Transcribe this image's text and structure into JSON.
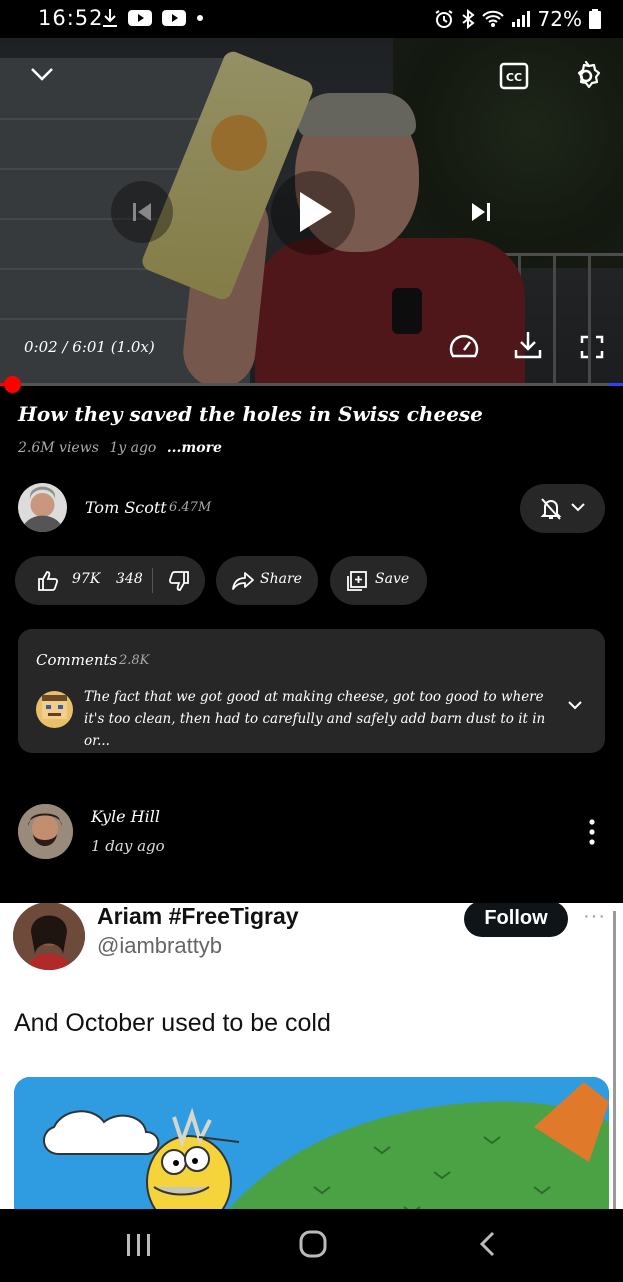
{
  "status_bar": {
    "time": "16:52",
    "battery": "72%",
    "left_icons": [
      "download-icon",
      "youtube-icon",
      "youtube-icon",
      "dot-icon"
    ],
    "right_icons": [
      "alarm-icon",
      "bluetooth-icon",
      "wifi-icon",
      "signal-icon",
      "battery-icon"
    ]
  },
  "player": {
    "time": "0:02 / 6:01 (1.0x)",
    "progress": 0.006,
    "icons": [
      "chevron-down-icon",
      "cc-icon",
      "gear-icon",
      "previous-icon",
      "play-icon",
      "next-icon",
      "speed-icon",
      "download-icon",
      "fullscreen-icon"
    ]
  },
  "video": {
    "title": "How they saved the holes in Swiss cheese",
    "views": "2.6M views",
    "age": "1y ago",
    "more": "...more"
  },
  "channel": {
    "name": "Tom Scott",
    "subscribers": "6.47M"
  },
  "actions": {
    "likes": "97K",
    "dislikes": "348",
    "share": "Share",
    "save": "Save"
  },
  "comments": {
    "title": "Comments",
    "count": "2.8K",
    "top_comment": "The fact that we got good at making cheese, got too good to where it's too clean, then had to carefully and safely add barn dust to it in or..."
  },
  "post": {
    "author": "Kyle Hill",
    "time": "1 day ago"
  },
  "tweet": {
    "name": "Ariam #FreeTigray",
    "handle": "@iambrattyb",
    "follow": "Follow",
    "more": "···",
    "text": "And October used to be cold"
  },
  "nav": {
    "icons": [
      "recents-icon",
      "home-icon",
      "back-icon"
    ]
  },
  "colors": {
    "accent_red": "#ff0000",
    "surface": "#272727",
    "background": "#000000"
  }
}
